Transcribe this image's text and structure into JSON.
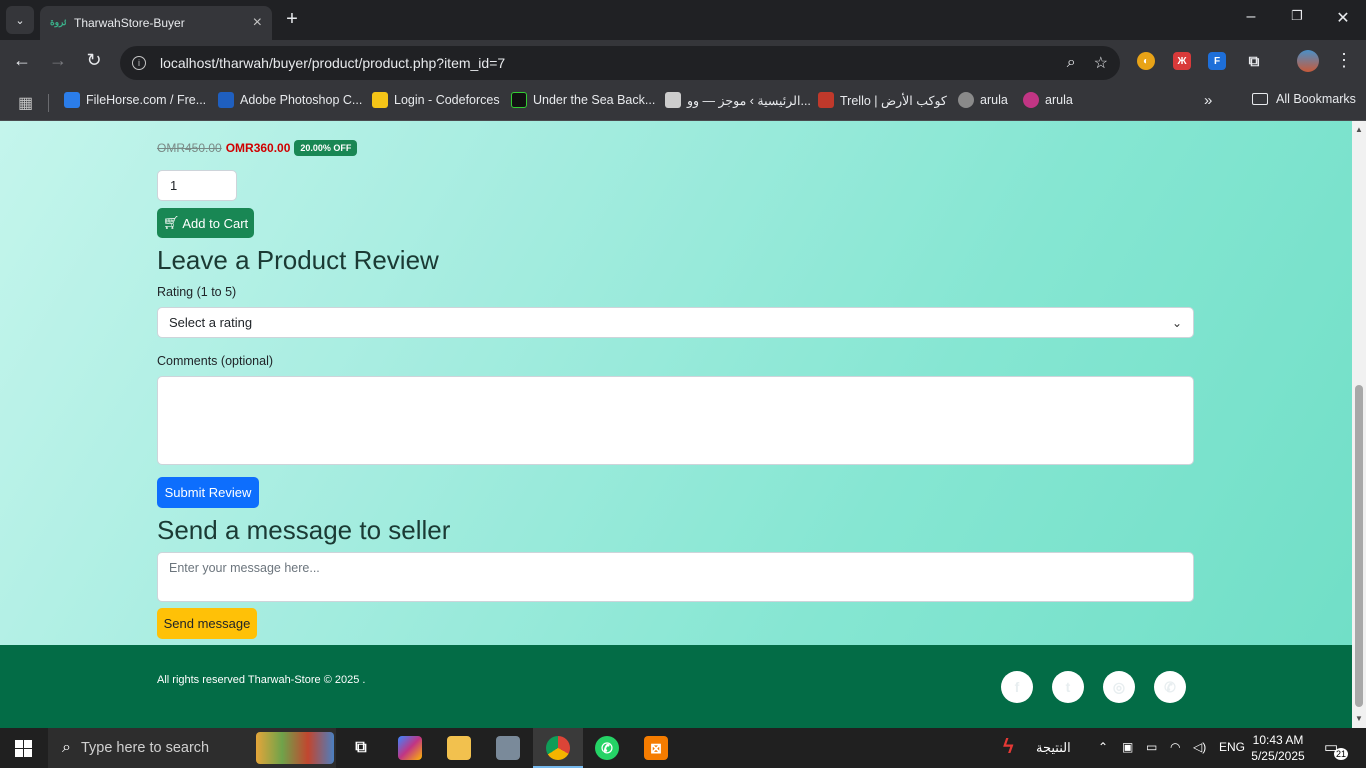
{
  "browser": {
    "tab_title": "TharwahStore-Buyer",
    "tab_favicon_text": "ثروة",
    "url": "localhost/tharwah/buyer/product/product.php?item_id=7",
    "bookmarks": [
      {
        "label": "FileHorse.com / Fre...",
        "color": "#2b7de9"
      },
      {
        "label": "Adobe Photoshop C...",
        "color": "#1f5fbf"
      },
      {
        "label": "Login - Codeforces",
        "color": "#f5c518"
      },
      {
        "label": "Under the Sea Back...",
        "color": "#111111"
      },
      {
        "label": "الرئيسية › موجز — وو...",
        "color": "#cccccc"
      },
      {
        "label": "Trello | كوكب الأرض",
        "color": "#c0392b"
      },
      {
        "label": "arula",
        "color": "#8a8a8a"
      },
      {
        "label": "arula",
        "color": "#c13584"
      }
    ],
    "all_bookmarks_label": "All Bookmarks"
  },
  "product": {
    "old_price": "OMR450.00",
    "new_price": "OMR360.00",
    "discount_badge": "20.00% OFF",
    "quantity": "1",
    "add_to_cart_label": "Add to Cart"
  },
  "review": {
    "heading": "Leave a Product Review",
    "rating_label": "Rating (1 to 5)",
    "rating_selected": "Select a rating",
    "comments_label": "Comments (optional)",
    "comments_value": "",
    "submit_label": "Submit Review"
  },
  "message": {
    "heading": "Send a message to seller",
    "placeholder": "Enter your message here...",
    "send_label": "Send message"
  },
  "footer": {
    "text": "All rights reserved Tharwah-Store © 2025 .",
    "social_icons": [
      "facebook-icon",
      "twitter-icon",
      "instagram-icon",
      "whatsapp-icon"
    ]
  },
  "taskbar": {
    "search_placeholder": "Type here to search",
    "weather_text": "النتيجة",
    "language": "ENG",
    "time": "10:43 AM",
    "date": "5/25/2025",
    "notification_count": "21"
  }
}
